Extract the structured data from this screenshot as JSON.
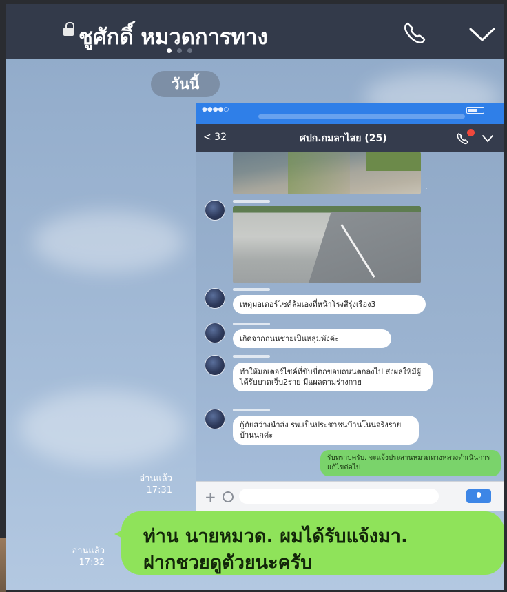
{
  "header": {
    "title": "ชูศักดิ์ หมวดการทาง",
    "page_dots": [
      true,
      false,
      false
    ]
  },
  "date_separator": "วันนี้",
  "embedded_screenshot": {
    "nav": {
      "back_label": "< 32",
      "title": "ศปก.กมลาไสย (25)"
    },
    "messages": [
      {
        "text": "เหตุมอเตอร์ไซค์ล้มเองที่หน้าโรงสีรุ่งเรือง3"
      },
      {
        "text": "เกิดจากถนนชายเป็นหลุมพังค่ะ"
      },
      {
        "text": "ทำให้มอเตอร์ไซค์ที่ขับขี่ตกขอบถนนตกลงไป ส่งผลให้มีผู้ได้รับบาดเจ็บ2ราย มีแผลตามร่างกาย"
      },
      {
        "text": "กู้ภัยสว่างนำส่ง รพ.เป็นประชาชนบ้านโนนจริงรายบ้านนกค่ะ"
      }
    ],
    "reply": {
      "text": "รับทราบครับ. จะแจ้งประสานหมวดทางหลวงดำเนินการแก้ไขต่อไป"
    }
  },
  "read_receipts": [
    {
      "status": "อ่านแล้ว",
      "time": "17:31"
    },
    {
      "status": "อ่านแล้ว",
      "time": "17:32"
    }
  ],
  "outgoing_message": {
    "line1": "ท่าน นายหมวด. ผมได้รับแจ้งมา.",
    "line2": "ฝากชวยดูตัวยนะครับ"
  },
  "colors": {
    "header_bg": "#333a4a",
    "chat_bg": "#9db5d2",
    "outgoing_bubble": "#8fe35a",
    "inner_statusbar": "#2f7fe8",
    "badge": "#f0483c"
  },
  "icons": [
    "lock-icon",
    "phone-icon",
    "chevron-down-icon",
    "plus-icon",
    "emoji-icon",
    "mic-icon"
  ]
}
